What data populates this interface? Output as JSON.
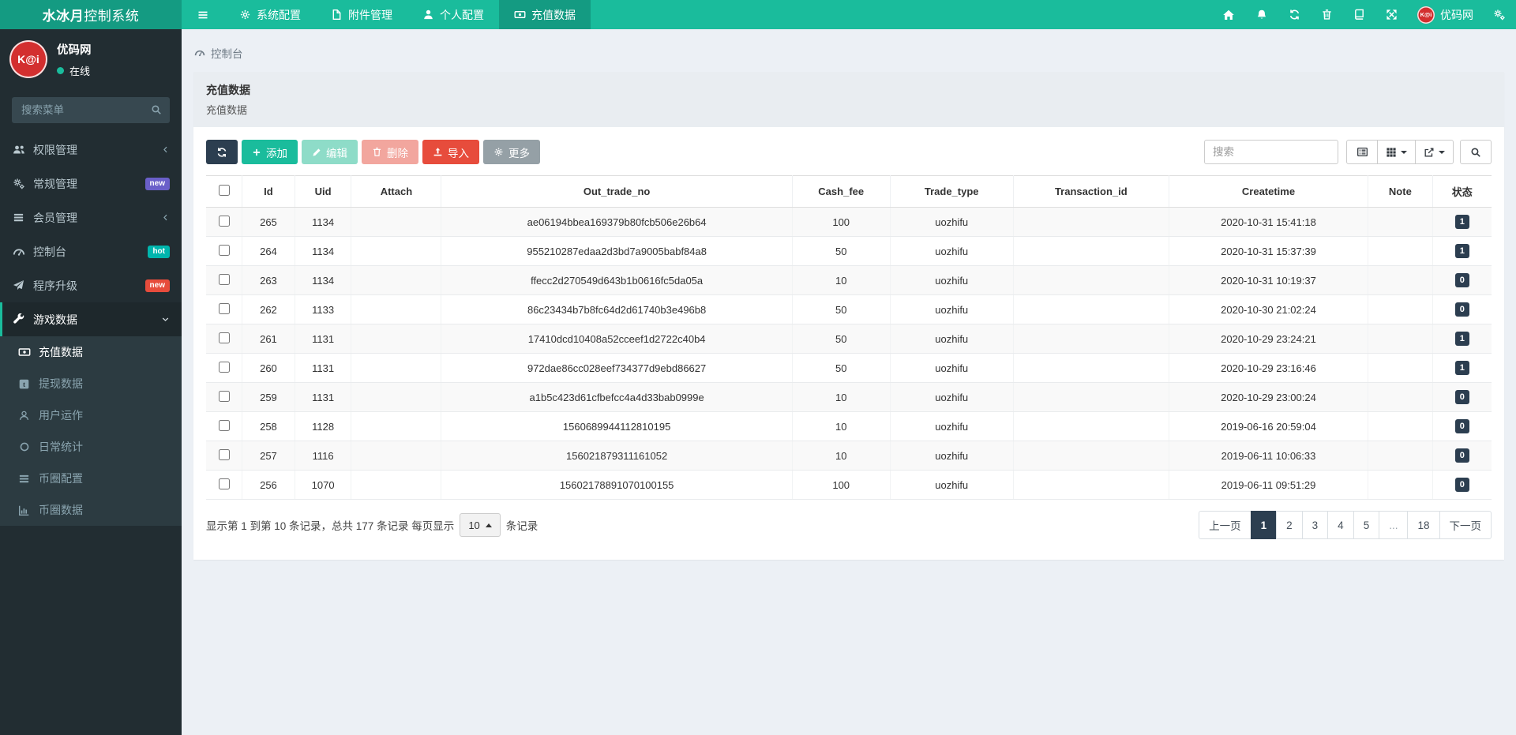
{
  "navbar": {
    "brand_bold": "水冰月",
    "brand_rest": "控制系统",
    "items": [
      {
        "label": "系统配置"
      },
      {
        "label": "附件管理"
      },
      {
        "label": "个人配置"
      },
      {
        "label": "充值数据"
      }
    ],
    "avatar_text": "K@i",
    "username": "优码网"
  },
  "sidebar": {
    "avatar_text": "K@i",
    "username": "优码网",
    "status": "在线",
    "search_placeholder": "搜索菜单",
    "menu": [
      {
        "label": "权限管理"
      },
      {
        "label": "常规管理",
        "badge": "new"
      },
      {
        "label": "会员管理"
      },
      {
        "label": "控制台",
        "badge": "hot"
      },
      {
        "label": "程序升级",
        "badge": "new"
      },
      {
        "label": "游戏数据"
      }
    ],
    "submenu": [
      {
        "label": "充值数据"
      },
      {
        "label": "提现数据"
      },
      {
        "label": "用户运作"
      },
      {
        "label": "日常统计"
      },
      {
        "label": "币圈配置"
      },
      {
        "label": "币圈数据"
      }
    ]
  },
  "breadcrumb": "控制台",
  "panel": {
    "title": "充值数据",
    "subtitle": "充值数据"
  },
  "toolbar": {
    "add": "添加",
    "edit": "编辑",
    "delete": "删除",
    "import": "导入",
    "more": "更多",
    "search_placeholder": "搜索"
  },
  "table": {
    "columns": [
      "Id",
      "Uid",
      "Attach",
      "Out_trade_no",
      "Cash_fee",
      "Trade_type",
      "Transaction_id",
      "Createtime",
      "Note",
      "状态"
    ],
    "rows": [
      {
        "id": "265",
        "uid": "1134",
        "attach": "",
        "out_trade_no": "ae06194bbea169379b80fcb506e26b64",
        "cash_fee": "100",
        "trade_type": "uozhifu",
        "transaction_id": "",
        "createtime": "2020-10-31 15:41:18",
        "note": "",
        "status": "1"
      },
      {
        "id": "264",
        "uid": "1134",
        "attach": "",
        "out_trade_no": "955210287edaa2d3bd7a9005babf84a8",
        "cash_fee": "50",
        "trade_type": "uozhifu",
        "transaction_id": "",
        "createtime": "2020-10-31 15:37:39",
        "note": "",
        "status": "1"
      },
      {
        "id": "263",
        "uid": "1134",
        "attach": "",
        "out_trade_no": "ffecc2d270549d643b1b0616fc5da05a",
        "cash_fee": "10",
        "trade_type": "uozhifu",
        "transaction_id": "",
        "createtime": "2020-10-31 10:19:37",
        "note": "",
        "status": "0"
      },
      {
        "id": "262",
        "uid": "1133",
        "attach": "",
        "out_trade_no": "86c23434b7b8fc64d2d61740b3e496b8",
        "cash_fee": "50",
        "trade_type": "uozhifu",
        "transaction_id": "",
        "createtime": "2020-10-30 21:02:24",
        "note": "",
        "status": "0"
      },
      {
        "id": "261",
        "uid": "1131",
        "attach": "",
        "out_trade_no": "17410dcd10408a52cceef1d2722c40b4",
        "cash_fee": "50",
        "trade_type": "uozhifu",
        "transaction_id": "",
        "createtime": "2020-10-29 23:24:21",
        "note": "",
        "status": "1"
      },
      {
        "id": "260",
        "uid": "1131",
        "attach": "",
        "out_trade_no": "972dae86cc028eef734377d9ebd86627",
        "cash_fee": "50",
        "trade_type": "uozhifu",
        "transaction_id": "",
        "createtime": "2020-10-29 23:16:46",
        "note": "",
        "status": "1"
      },
      {
        "id": "259",
        "uid": "1131",
        "attach": "",
        "out_trade_no": "a1b5c423d61cfbefcc4a4d33bab0999e",
        "cash_fee": "10",
        "trade_type": "uozhifu",
        "transaction_id": "",
        "createtime": "2020-10-29 23:00:24",
        "note": "",
        "status": "0"
      },
      {
        "id": "258",
        "uid": "1128",
        "attach": "",
        "out_trade_no": "1560689944112810195",
        "cash_fee": "10",
        "trade_type": "uozhifu",
        "transaction_id": "",
        "createtime": "2019-06-16 20:59:04",
        "note": "",
        "status": "0"
      },
      {
        "id": "257",
        "uid": "1116",
        "attach": "",
        "out_trade_no": "156021879311161052",
        "cash_fee": "10",
        "trade_type": "uozhifu",
        "transaction_id": "",
        "createtime": "2019-06-11 10:06:33",
        "note": "",
        "status": "0"
      },
      {
        "id": "256",
        "uid": "1070",
        "attach": "",
        "out_trade_no": "15602178891070100155",
        "cash_fee": "100",
        "trade_type": "uozhifu",
        "transaction_id": "",
        "createtime": "2019-06-11 09:51:29",
        "note": "",
        "status": "0"
      }
    ]
  },
  "pagination": {
    "summary_prefix": "显示第 1 到第 10 条记录，总共 177 条记录 每页显示",
    "per_page": "10",
    "summary_suffix": "条记录",
    "prev": "上一页",
    "next": "下一页",
    "pages": [
      "1",
      "2",
      "3",
      "4",
      "5",
      "...",
      "18"
    ],
    "active_page": "1"
  },
  "colors": {
    "navbar_teal": "#1abc9c",
    "navbar_dark_teal": "#149b82",
    "sidebar_bg": "#222d32",
    "submenu_bg": "#2c3b41",
    "content_bg": "#ecf0f5",
    "primary_dark": "#2c3e50",
    "danger_red": "#e74c3c",
    "gray_button": "#95a0a6",
    "badge_new_purple": "#6a5fc9",
    "badge_hot_teal": "#00b5ad",
    "badge_new_red": "#e74c3c",
    "avatar_red": "#d32f2f",
    "online_dot": "#1abc9c"
  }
}
